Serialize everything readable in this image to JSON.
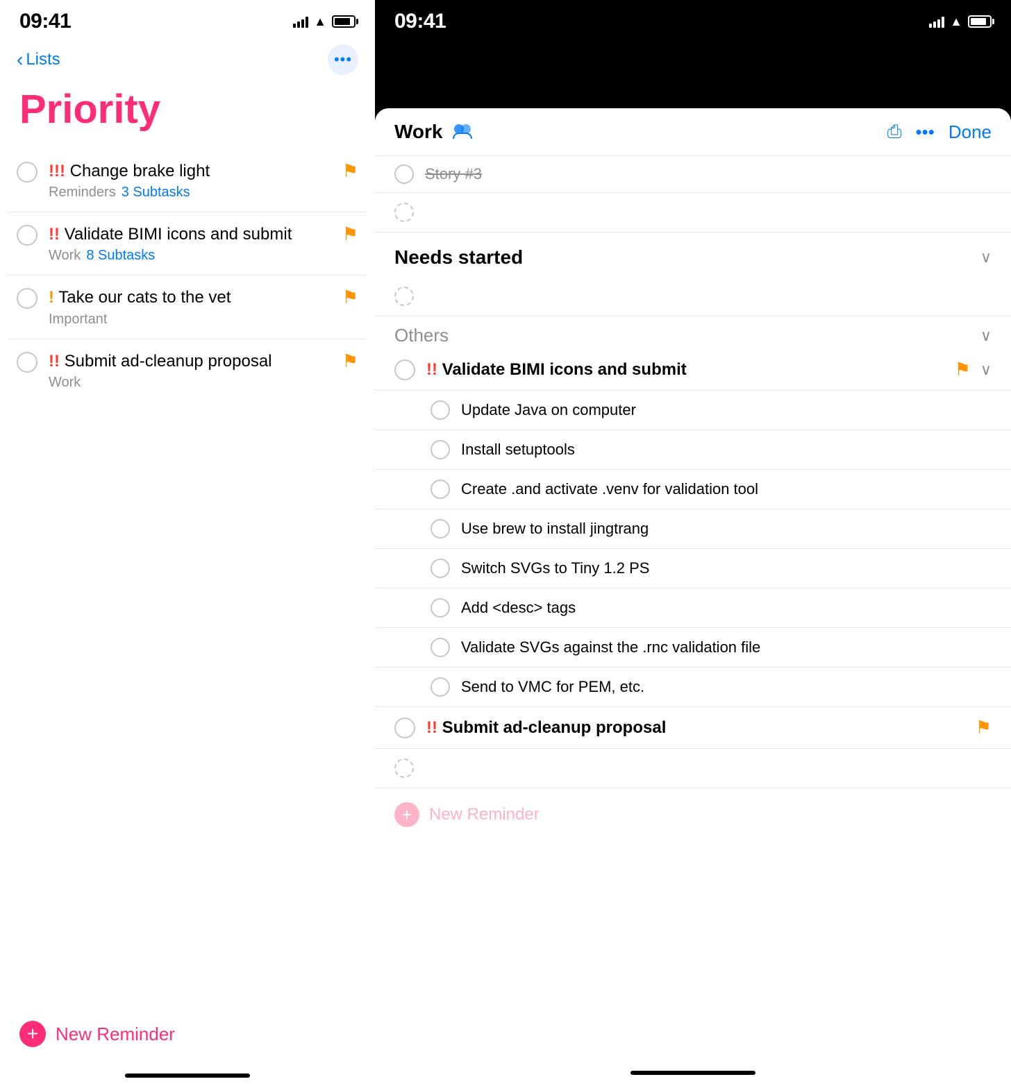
{
  "left": {
    "statusBar": {
      "time": "09:41"
    },
    "nav": {
      "backLabel": "Lists"
    },
    "pageTitle": "Priority",
    "reminders": [
      {
        "id": "change-brake",
        "priorityMark": "!!!",
        "title": "Change brake light",
        "subList": "Reminders",
        "subTasks": "3 Subtasks",
        "flagged": true
      },
      {
        "id": "validate-bimi",
        "priorityMark": "!!",
        "title": "Validate BIMI icons and submit",
        "subList": "Work",
        "subTasks": "8 Subtasks",
        "flagged": true
      },
      {
        "id": "cats-vet",
        "priorityMark": "!",
        "title": "Take our cats to the vet",
        "subList": "Important",
        "subTasks": null,
        "flagged": true
      },
      {
        "id": "ad-cleanup",
        "priorityMark": "!!",
        "title": "Submit ad-cleanup proposal",
        "subList": "Work",
        "subTasks": null,
        "flagged": true
      }
    ],
    "newReminder": "New Reminder"
  },
  "right": {
    "statusBar": {
      "time": "09:41"
    },
    "header": {
      "title": "Work",
      "doneLabel": "Done"
    },
    "storyItem": {
      "title": "Story #3"
    },
    "needsStarted": {
      "sectionTitle": "Needs started"
    },
    "othersSection": {
      "title": "Others"
    },
    "validateTask": {
      "priorityMark": "!!",
      "title": "Validate BIMI icons and submit",
      "flagged": true,
      "subtasks": [
        {
          "id": "st1",
          "title": "Update Java on computer"
        },
        {
          "id": "st2",
          "title": "Install setuptools"
        },
        {
          "id": "st3",
          "title": "Create .and activate .venv for validation tool"
        },
        {
          "id": "st4",
          "title": "Use brew to install jingtrang"
        },
        {
          "id": "st5",
          "title": "Switch SVGs to Tiny 1.2 PS"
        },
        {
          "id": "st6",
          "title": "Add <desc> tags"
        },
        {
          "id": "st7",
          "title": "Validate SVGs against the .rnc validation file"
        },
        {
          "id": "st8",
          "title": "Send to VMC for PEM, etc."
        }
      ]
    },
    "submitTask": {
      "priorityMark": "!!",
      "title": "Submit ad-cleanup proposal",
      "flagged": true
    },
    "newReminder": "New Reminder"
  }
}
